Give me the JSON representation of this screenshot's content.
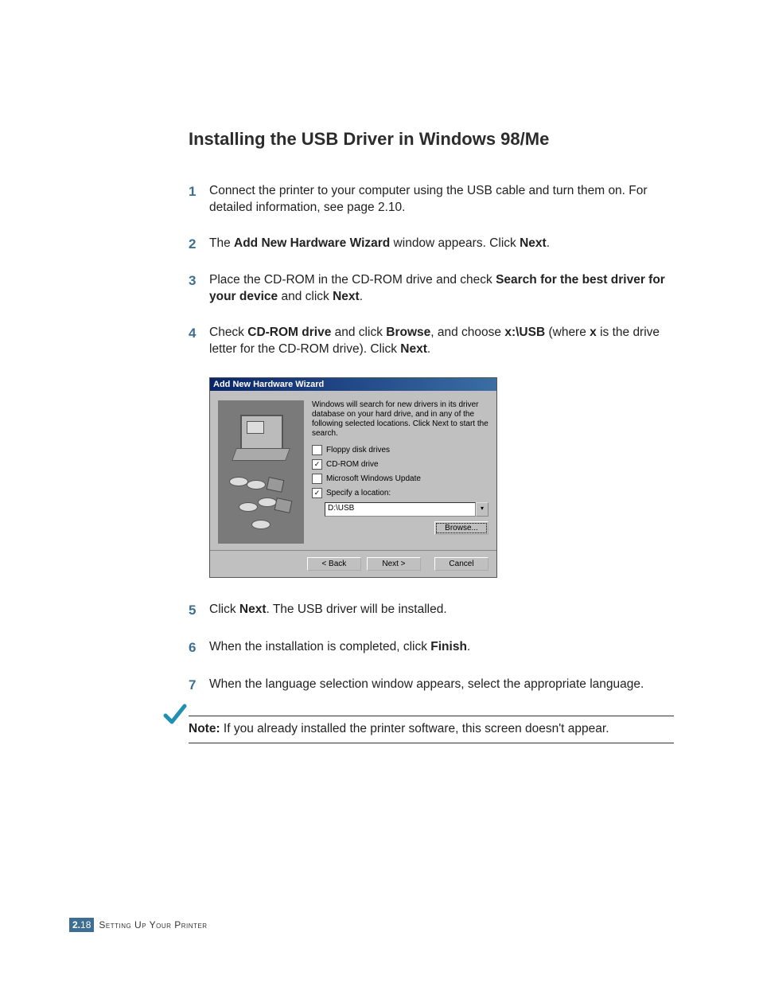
{
  "heading": "Installing the USB Driver in Windows 98/Me",
  "steps": {
    "s1": {
      "num": "1",
      "text": "Connect the printer to your computer using the USB cable and turn them on. For detailed information, see page 2.10."
    },
    "s2": {
      "num": "2",
      "pre": "The ",
      "b1": "Add New Hardware Wizard",
      "mid": " window appears. Click ",
      "b2": "Next",
      "post": "."
    },
    "s3": {
      "num": "3",
      "pre": "Place the CD-ROM in the CD-ROM drive and check ",
      "b1": "Search for the best driver for your device",
      "mid": " and click ",
      "b2": "Next",
      "post": "."
    },
    "s4": {
      "num": "4",
      "pre": "Check ",
      "b1": "CD-ROM drive",
      "mid1": " and click ",
      "b2": "Browse",
      "mid2": ", and choose ",
      "b3": "x:\\USB",
      "mid3": " (where ",
      "b4": "x",
      "mid4": " is the drive letter for the CD-ROM drive). Click ",
      "b5": "Next",
      "post": "."
    },
    "s5": {
      "num": "5",
      "pre": "Click ",
      "b1": "Next",
      "post": ". The USB driver will be installed."
    },
    "s6": {
      "num": "6",
      "pre": "When the installation is completed, click ",
      "b1": "Finish",
      "post": "."
    },
    "s7": {
      "num": "7",
      "text": "When the language selection window appears, select the appropriate language."
    }
  },
  "wizard": {
    "title": "Add New Hardware Wizard",
    "intro": "Windows will search for new drivers in its driver database on your hard drive, and in any of the following selected locations. Click Next to start the search.",
    "opt_floppy": "Floppy disk drives",
    "opt_cdrom": "CD-ROM drive",
    "opt_winupdate": "Microsoft Windows Update",
    "opt_location": "Specify a location:",
    "location_value": "D:\\USB",
    "browse": "Browse...",
    "back": "< Back",
    "next": "Next >",
    "cancel": "Cancel"
  },
  "note": {
    "label": "Note:",
    "text": " If you already installed the printer software, this screen doesn't appear."
  },
  "footer": {
    "chapter": "2.",
    "page": "18",
    "title": "Setting Up Your Printer"
  }
}
